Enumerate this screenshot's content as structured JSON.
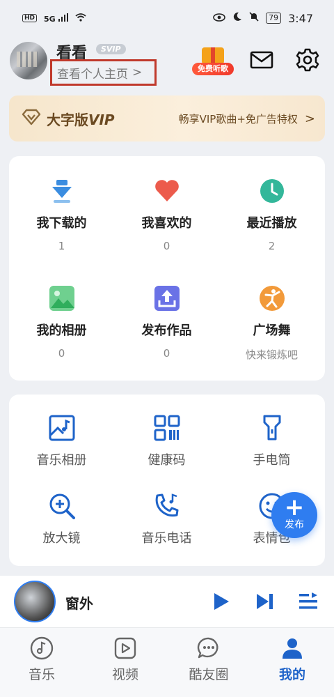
{
  "status_bar": {
    "left_badge": "HD",
    "signal": "5G",
    "battery": "79",
    "time": "3:47"
  },
  "profile": {
    "username": "看看",
    "badge": "SVIP",
    "link_label": "查看个人主页",
    "link_chevron": ">",
    "gift_label": "免费听歌"
  },
  "vip_banner": {
    "title_prefix": "大字版",
    "title_suffix": "VIP",
    "description": "畅享VIP歌曲+免广告特权",
    "chevron": ">"
  },
  "library": [
    {
      "label": "我下载的",
      "count": "1",
      "icon": "download-icon",
      "color": "#3b8de0"
    },
    {
      "label": "我喜欢的",
      "count": "0",
      "icon": "heart-icon",
      "color": "#ec5b4c"
    },
    {
      "label": "最近播放",
      "count": "2",
      "icon": "clock-icon",
      "color": "#33b79a"
    },
    {
      "label": "我的相册",
      "count": "0",
      "icon": "image-icon",
      "color": "#55c779"
    },
    {
      "label": "发布作品",
      "count": "0",
      "icon": "upload-icon",
      "color": "#6a72e6"
    },
    {
      "label": "广场舞",
      "count": "快来锻炼吧",
      "icon": "dance-icon",
      "color": "#f29a3a"
    }
  ],
  "tools": [
    {
      "label": "音乐相册",
      "icon": "music-album-icon"
    },
    {
      "label": "健康码",
      "icon": "qr-code-icon"
    },
    {
      "label": "手电筒",
      "icon": "flashlight-icon"
    },
    {
      "label": "放大镜",
      "icon": "magnifier-icon"
    },
    {
      "label": "音乐电话",
      "icon": "music-phone-icon"
    },
    {
      "label": "表情包",
      "icon": "emoji-icon"
    }
  ],
  "fab": {
    "label": "发布"
  },
  "player": {
    "title": "窗外"
  },
  "tabs": [
    {
      "label": "音乐",
      "icon": "music-note-icon",
      "active": false
    },
    {
      "label": "视频",
      "icon": "video-play-icon",
      "active": false
    },
    {
      "label": "酷友圈",
      "icon": "chat-bubble-icon",
      "active": false
    },
    {
      "label": "我的",
      "icon": "person-icon",
      "active": true
    }
  ],
  "colors": {
    "accent": "#2f7df0",
    "tab_active": "#1e63c9",
    "highlight_box": "#c0392b",
    "vip_text": "#6b4a22"
  }
}
